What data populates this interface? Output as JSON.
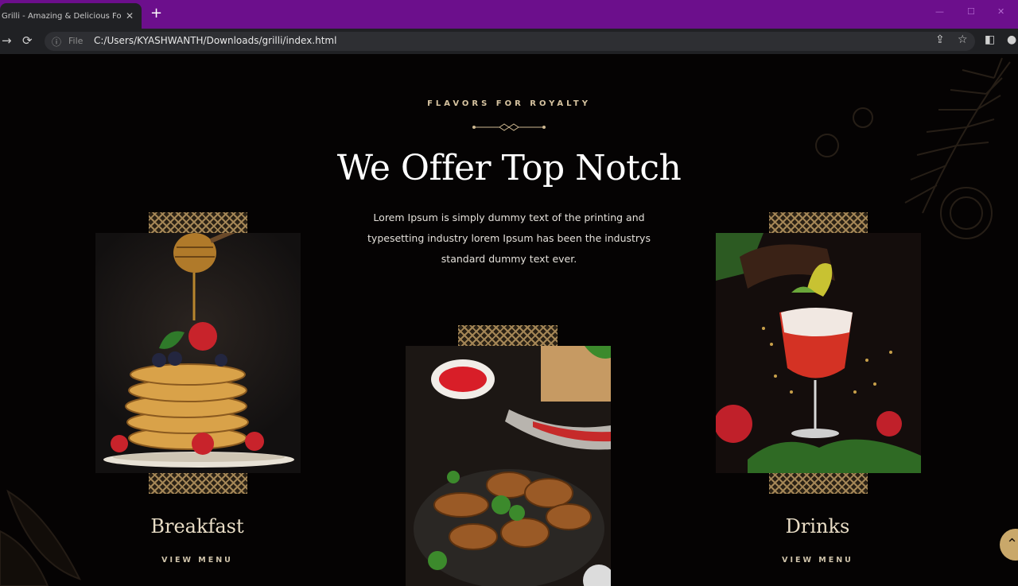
{
  "browser": {
    "tab_title": "Grilli - Amazing & Delicious Food",
    "tab_close": "✕",
    "new_tab": "+",
    "scheme_label": "File",
    "url": "C:/Users/KYASHWANTH/Downloads/grilli/index.html",
    "accent_color": "#6c0f8c"
  },
  "section": {
    "subtitle": "FLAVORS FOR ROYALTY",
    "title": "We Offer Top Notch",
    "description": "Lorem Ipsum is simply dummy text of the printing and typesetting industry lorem Ipsum has been the industrys standard dummy text ever."
  },
  "cards": [
    {
      "title": "Breakfast",
      "link": "VIEW MENU",
      "image": "pancakes-photo"
    },
    {
      "title": "",
      "link": "",
      "image": "grilled-chicken-photo"
    },
    {
      "title": "Drinks",
      "link": "VIEW MENU",
      "image": "cocktail-photo"
    }
  ],
  "colors": {
    "gold": "#c9a86a",
    "background": "#050303"
  },
  "icons": {
    "back": "arrow-left-icon",
    "reload": "reload-icon",
    "share": "share-icon",
    "bookmark": "star-icon",
    "sidepanel": "side-panel-icon",
    "scroll_top": "chevron-up-icon"
  }
}
